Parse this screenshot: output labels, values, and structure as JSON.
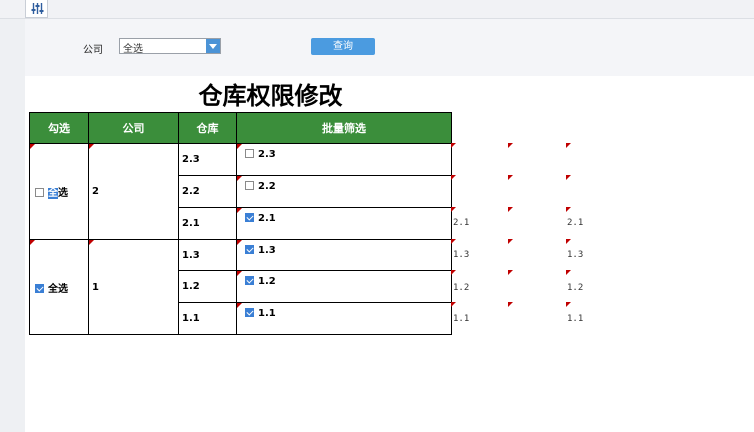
{
  "filter": {
    "company_label": "公司",
    "company_value": "全选",
    "query_label": "查询"
  },
  "report": {
    "title": "仓库权限修改",
    "headers": [
      "勾选",
      "公司",
      "仓库",
      "批量筛选"
    ],
    "groups": [
      {
        "select_all_label": "全选",
        "select_all_checked": false,
        "company": "2",
        "rows": [
          {
            "warehouse": "2.3",
            "batch_label": "2.3",
            "checked": false
          },
          {
            "warehouse": "2.2",
            "batch_label": "2.2",
            "checked": false
          },
          {
            "warehouse": "2.1",
            "batch_label": "2.1",
            "checked": true
          }
        ]
      },
      {
        "select_all_label": "全选",
        "select_all_checked": true,
        "company": "1",
        "rows": [
          {
            "warehouse": "1.3",
            "batch_label": "1.3",
            "checked": true
          },
          {
            "warehouse": "1.2",
            "batch_label": "1.2",
            "checked": true
          },
          {
            "warehouse": "1.1",
            "batch_label": "1.1",
            "checked": true
          }
        ]
      }
    ]
  },
  "extra_columns": {
    "col_a": [
      "",
      "",
      "2.1",
      "1.3",
      "1.2",
      "1.1"
    ],
    "col_b": [
      "",
      "",
      "2.1",
      "1.3",
      "1.2",
      "1.1"
    ]
  },
  "colors": {
    "header_green": "#3b8e3b",
    "accent_blue": "#4b9be0",
    "marker_red": "#c00000"
  },
  "icons": {
    "toolbar": "sliders-icon",
    "dropdown": "chevron-down-icon"
  }
}
